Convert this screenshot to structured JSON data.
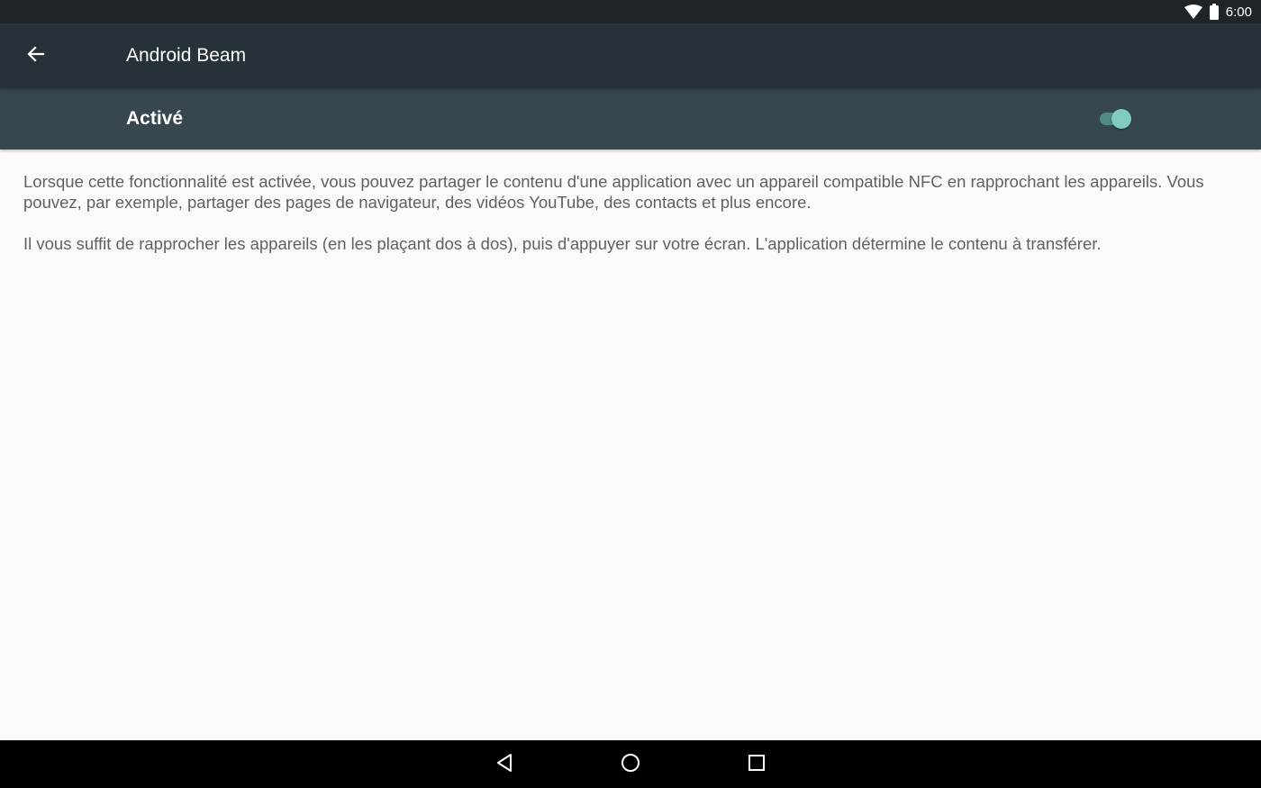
{
  "status_bar": {
    "time": "6:00",
    "icons": [
      "wifi-icon",
      "battery-icon"
    ]
  },
  "toolbar": {
    "back_icon": "arrow-back-icon",
    "title": "Android Beam"
  },
  "switch_bar": {
    "label": "Activé",
    "toggle_on": true,
    "accent_color": "#80cbc4"
  },
  "content": {
    "paragraphs": [
      "Lorsque cette fonctionnalité est activée, vous pouvez partager le contenu d'une application avec un appareil compatible NFC en rapprochant les appareils. Vous pouvez, par exemple, partager des pages de navigateur, des vidéos YouTube, des contacts et plus encore.",
      "Il vous suffit de rapprocher les appareils (en les plaçant dos à dos), puis d'appuyer sur votre écran. L'application détermine le contenu à transférer."
    ]
  },
  "nav_bar": {
    "buttons": [
      "back-triangle-icon",
      "home-circle-icon",
      "recents-square-icon"
    ]
  },
  "colors": {
    "status_bar": "#1f2428",
    "toolbar": "#263238",
    "switch_bar": "#37474f",
    "background": "#fafafa",
    "body_text": "#616161"
  }
}
